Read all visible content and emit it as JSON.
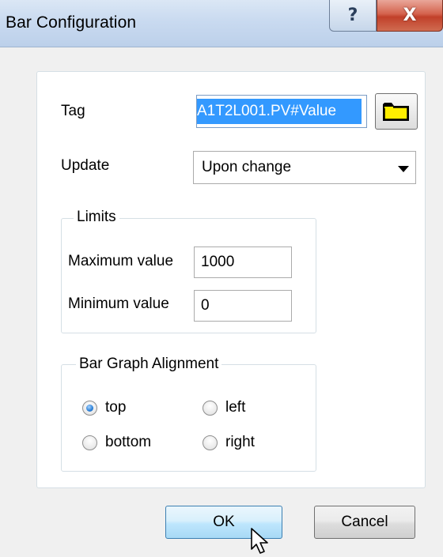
{
  "window": {
    "title": "Bar Configuration",
    "help_glyph": "?",
    "close_glyph": "X"
  },
  "tag": {
    "label": "Tag",
    "value": "A1T2L001.PV#Value",
    "browse_icon": "folder-icon"
  },
  "update": {
    "label": "Update",
    "selected": "Upon change"
  },
  "limits": {
    "caption": "Limits",
    "max_label": "Maximum value",
    "max_value": "1000",
    "min_label": "Minimum value",
    "min_value": "0"
  },
  "alignment": {
    "caption": "Bar Graph Alignment",
    "options": [
      {
        "label": "top",
        "checked": true
      },
      {
        "label": "left",
        "checked": false
      },
      {
        "label": "bottom",
        "checked": false
      },
      {
        "label": "right",
        "checked": false
      }
    ]
  },
  "buttons": {
    "ok": "OK",
    "cancel": "Cancel"
  },
  "colors": {
    "selection": "#3399ff",
    "ok_border": "#3c7fb1",
    "close_red": "#c1402a"
  }
}
